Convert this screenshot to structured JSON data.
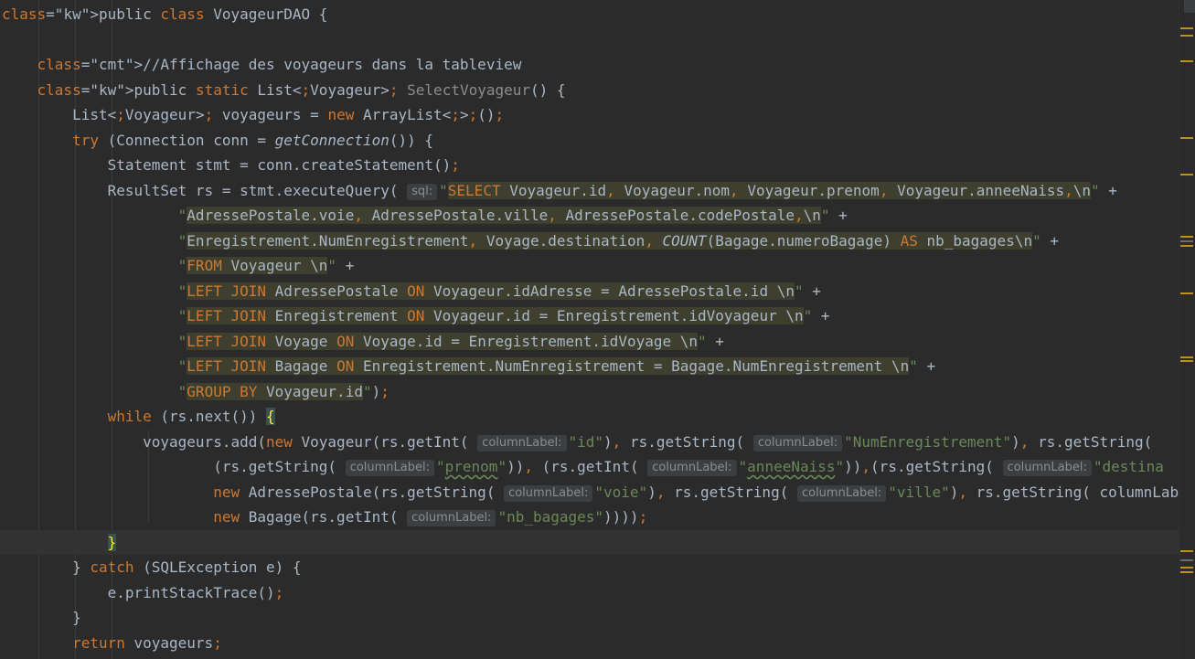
{
  "editor": {
    "lines": [
      {
        "t": "public class VoyageurDAO {"
      },
      {
        "t": ""
      },
      {
        "t": "    //Affichage des voyageurs dans la tableview"
      },
      {
        "t": "    public static List<Voyageur> SelectVoyageur() {"
      },
      {
        "t": "        List<Voyageur> voyageurs = new ArrayList<>();"
      },
      {
        "t": "        try (Connection conn = getConnection()) {"
      },
      {
        "t": "            Statement stmt = conn.createStatement();"
      },
      {
        "t": "            ResultSet rs = stmt.executeQuery( sql: \"SELECT Voyageur.id, Voyageur.nom, Voyageur.prenom, Voyageur.anneeNaiss,\\n\" +"
      },
      {
        "t": "                    \"AdressePostale.voie, AdressePostale.ville, AdressePostale.codePostale,\\n\" +"
      },
      {
        "t": "                    \"Enregistrement.NumEnregistrement, Voyage.destination, COUNT(Bagage.numeroBagage) AS nb_bagages\\n\" +"
      },
      {
        "t": "                    \"FROM Voyageur \\n\" +"
      },
      {
        "t": "                    \"LEFT JOIN AdressePostale ON Voyageur.idAdresse = AdressePostale.id \\n\" +"
      },
      {
        "t": "                    \"LEFT JOIN Enregistrement ON Voyageur.id = Enregistrement.idVoyageur \\n\" +"
      },
      {
        "t": "                    \"LEFT JOIN Voyage ON Voyage.id = Enregistrement.idVoyage \\n\" +"
      },
      {
        "t": "                    \"LEFT JOIN Bagage ON Enregistrement.NumEnregistrement = Bagage.NumEnregistrement \\n\" +"
      },
      {
        "t": "                    \"GROUP BY Voyageur.id\");"
      },
      {
        "t": "            while (rs.next()) {"
      },
      {
        "t": "                voyageurs.add(new Voyageur(rs.getInt( columnLabel: \"id\"), rs.getString( columnLabel: \"NumEnregistrement\"), rs.getString( "
      },
      {
        "t": "                        (rs.getString( columnLabel: \"prenom\")), (rs.getInt( columnLabel: \"anneeNaiss\")),(rs.getString( columnLabel: \"destina"
      },
      {
        "t": "                        new AdressePostale(rs.getString( columnLabel: \"voie\"), rs.getString( columnLabel: \"ville\"), rs.getString( columnLab"
      },
      {
        "t": "                        new Bagage(rs.getInt( columnLabel: \"nb_bagages\"))));"
      },
      {
        "t": "            }"
      },
      {
        "t": "        } catch (SQLException e) {"
      },
      {
        "t": "            e.printStackTrace();"
      },
      {
        "t": "        }"
      },
      {
        "t": "        return voyageurs;"
      }
    ],
    "hint_labels": {
      "sql": "sql:",
      "column": "columnLabel:"
    },
    "colors": {
      "background": "#2b2b2b",
      "keyword": "#cc7832",
      "string": "#6a8759",
      "comment": "#808080",
      "text": "#a9b7c6",
      "sql_bg": "#3f3f2f"
    }
  }
}
